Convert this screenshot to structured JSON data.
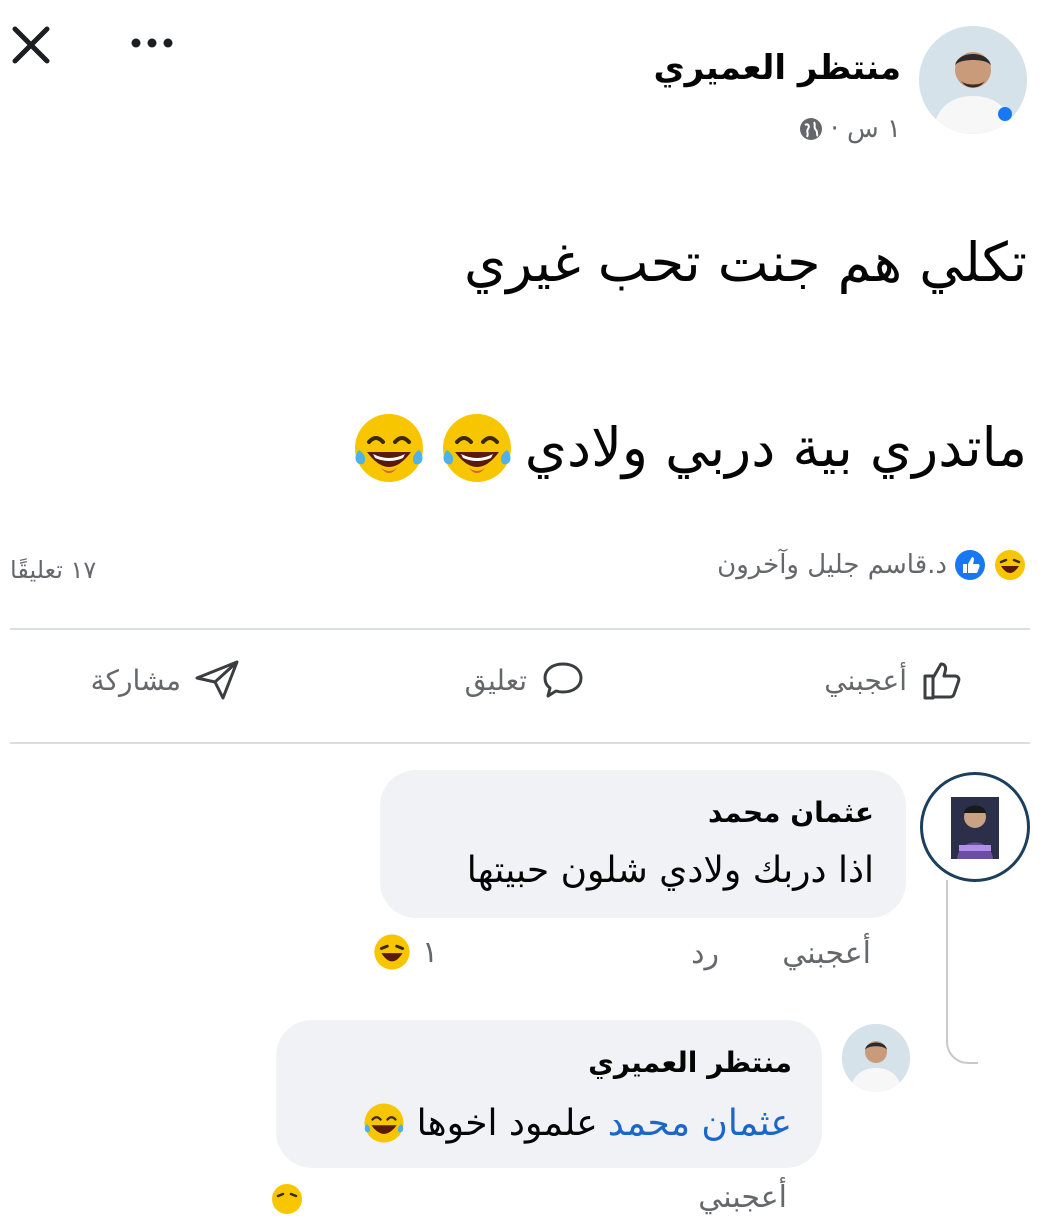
{
  "post": {
    "author": "منتظر العميري",
    "time": "١ س ·",
    "line1": "تكلي هم جنت تحب غيري",
    "line2": "ماتدري بية دربي ولادي"
  },
  "reactions": {
    "names": "د.قاسم جليل وآخرون",
    "comments_count": "١٧ تعليقًا"
  },
  "actions": {
    "like": "أعجبني",
    "comment": "تعليق",
    "share": "مشاركة"
  },
  "comments": [
    {
      "author": "عثمان محمد",
      "text": "اذا دربك ولادي شلون حبيتها",
      "like_label": "أعجبني",
      "reply_label": "رد",
      "reaction_count": "١"
    }
  ],
  "reply": {
    "author": "منتظر العميري",
    "mention": "عثمان محمد",
    "text": "علمود اخوها",
    "like_label": "أعجبني"
  },
  "colors": {
    "mention": "#1b66c9",
    "secondary_text": "#65676b",
    "bubble_bg": "#f0f2f5"
  }
}
